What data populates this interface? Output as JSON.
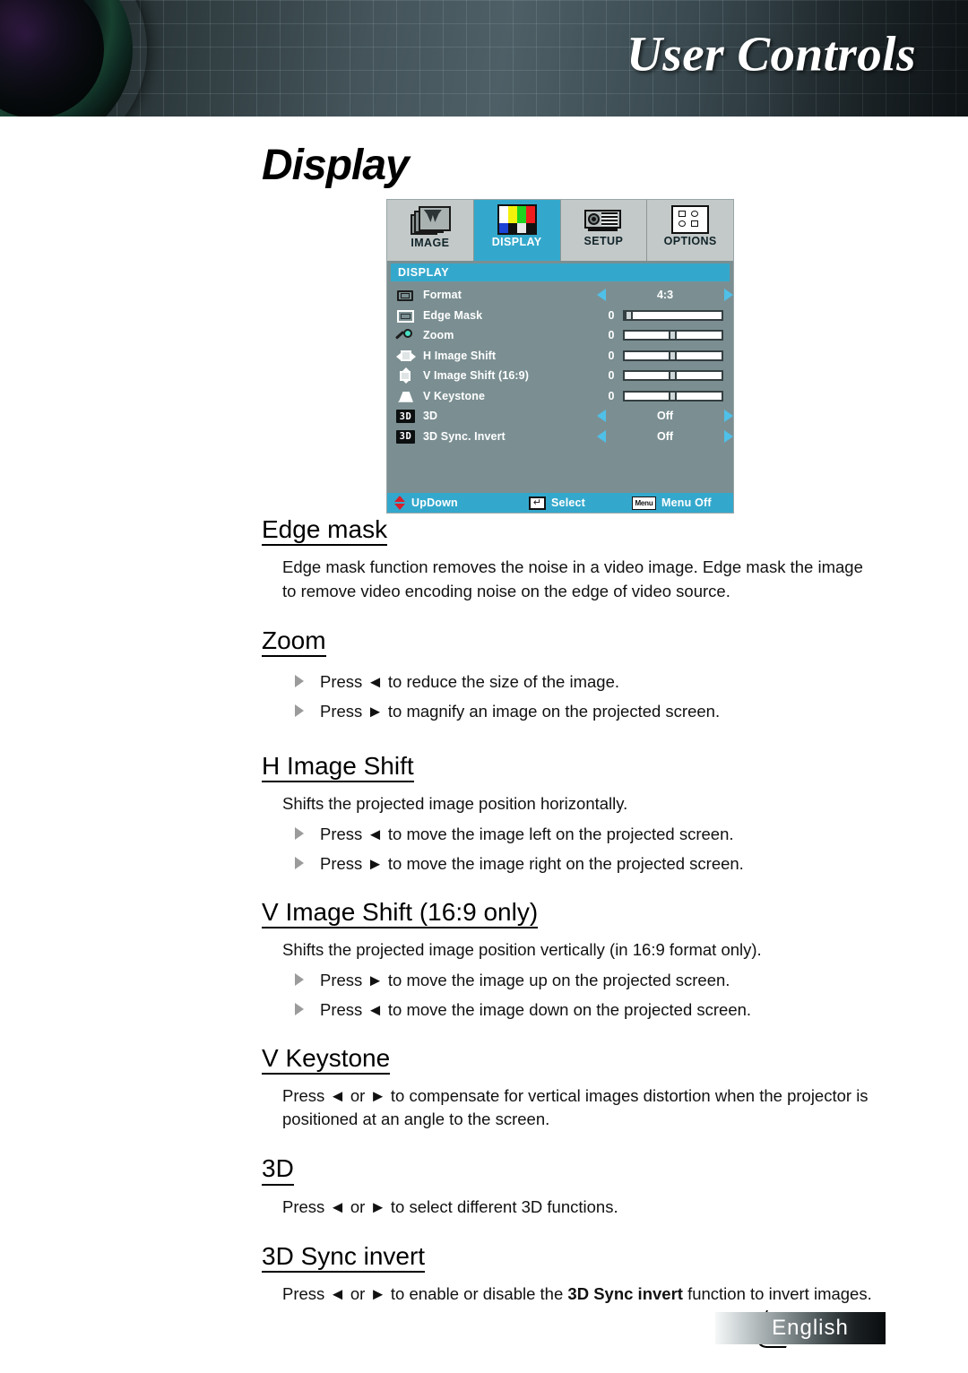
{
  "header": {
    "title": "User Controls",
    "lens_icon": "camera-lens-graphic"
  },
  "page_title": "Display",
  "osd": {
    "tabs": [
      {
        "label": "IMAGE",
        "icon": "stacked-photos-icon",
        "active": false
      },
      {
        "label": "DISPLAY",
        "icon": "color-bars-icon",
        "active": true
      },
      {
        "label": "SETUP",
        "icon": "projector-icon",
        "active": false
      },
      {
        "label": "OPTIONS",
        "icon": "options-grid-icon",
        "active": false
      }
    ],
    "display_icon_colors": [
      "#ffffff",
      "#f2f20a",
      "#1fd21f",
      "#ee1c1c",
      "#1b43d6",
      "#111111",
      "#e8e8e8",
      "#111111"
    ],
    "section_title": "DISPLAY",
    "rows": [
      {
        "icon": "screen-format-icon",
        "label": "Format",
        "type": "option",
        "value": "4:3"
      },
      {
        "icon": "edge-mask-icon",
        "label": "Edge Mask",
        "type": "slider",
        "value": "0",
        "knob_pct": 1
      },
      {
        "icon": "magnifier-icon",
        "label": "Zoom",
        "type": "slider",
        "value": "0",
        "knob_pct": 46
      },
      {
        "icon": "h-image-shift-icon",
        "label": "H Image Shift",
        "type": "slider",
        "value": "0",
        "knob_pct": 46
      },
      {
        "icon": "v-image-shift-icon",
        "label": "V Image Shift (16:9)",
        "type": "slider",
        "value": "0",
        "knob_pct": 46
      },
      {
        "icon": "keystone-icon",
        "label": "V Keystone",
        "type": "slider",
        "value": "0",
        "knob_pct": 46
      },
      {
        "icon": "3d-badge-icon",
        "label": "3D",
        "type": "option",
        "value": "Off"
      },
      {
        "icon": "3d-badge-icon",
        "label": "3D Sync. Invert",
        "type": "option",
        "value": "Off"
      }
    ],
    "footer": [
      {
        "icon": "up-down-arrows-icon",
        "label": "UpDown"
      },
      {
        "icon": "enter-key-icon",
        "label": "Select",
        "glyph": "↵"
      },
      {
        "icon": "menu-key-icon",
        "label": "Menu Off",
        "glyph": "Menu"
      }
    ],
    "accent_color": "#34a8cc",
    "panel_color": "#7b8f92"
  },
  "sections": [
    {
      "heading": "Edge mask",
      "paragraph": "Edge mask function removes the noise in a video image. Edge mask the image to remove video encoding noise on the edge of video source.",
      "bullets": []
    },
    {
      "heading": "Zoom",
      "paragraph": "",
      "bullets": [
        "Press ◄ to reduce the size of the image.",
        "Press ► to magnify an image on the projected screen."
      ]
    },
    {
      "heading": "H Image Shift",
      "paragraph": "Shifts the projected image position horizontally.",
      "bullets": [
        "Press ◄ to move the image left on the projected screen.",
        "Press ► to move the image right on the projected screen."
      ]
    },
    {
      "heading": "V Image Shift (16:9 only)",
      "paragraph": "Shifts the projected image position vertically (in 16:9 format only).",
      "bullets": [
        "Press ► to move the image up on the projected screen.",
        "Press ◄ to move the image down on the projected screen."
      ]
    },
    {
      "heading": "V Keystone",
      "paragraph": "Press ◄ or ► to compensate for vertical images distortion when the projector is positioned at an angle to the screen.",
      "bullets": []
    },
    {
      "heading": "3D",
      "paragraph": "Press ◄ or ► to select different 3D functions.",
      "bullets": []
    },
    {
      "heading": "3D Sync invert",
      "paragraph_parts": [
        "Press ◄ or ► to enable or disable the ",
        "3D Sync invert",
        " function to invert images."
      ],
      "bullets": []
    }
  ],
  "footer": {
    "page_number": "31",
    "language": "English"
  }
}
